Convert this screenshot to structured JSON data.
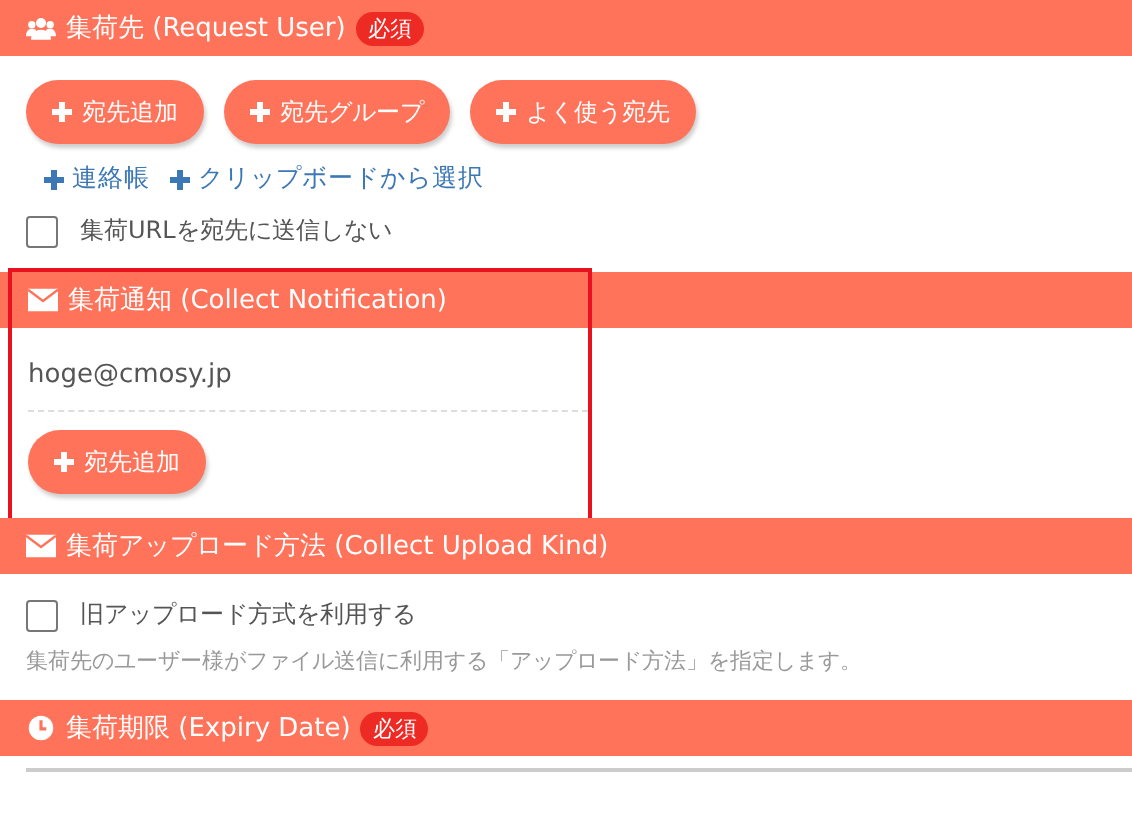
{
  "sections": [
    {
      "kind": "recipients",
      "title": "集荷先 (Request User)",
      "required": "必須",
      "highlighted": false,
      "buttons": [
        "宛先追加",
        "宛先グループ",
        "よく使う宛先"
      ],
      "links": [
        "連絡帳",
        "クリップボードから選択"
      ],
      "checkbox": {
        "label": "集荷URLを宛先に送信しない",
        "checked": false
      }
    },
    {
      "kind": "notification",
      "title": "集荷通知 (Collect Notification)",
      "highlighted": true,
      "emails": [
        "hoge@cmosy.jp"
      ],
      "buttons": [
        "宛先追加"
      ]
    },
    {
      "kind": "upload",
      "title": "集荷アップロード方法 (Collect Upload Kind)",
      "highlighted": false,
      "checkbox": {
        "label": "旧アップロード方式を利用する",
        "checked": false
      },
      "note": "集荷先のユーザー様がファイル送信に利用する「アップロード方法」を指定します。"
    },
    {
      "kind": "expiry",
      "title": "集荷期限 (Expiry Date)",
      "required": "必須",
      "highlighted": false
    }
  ]
}
